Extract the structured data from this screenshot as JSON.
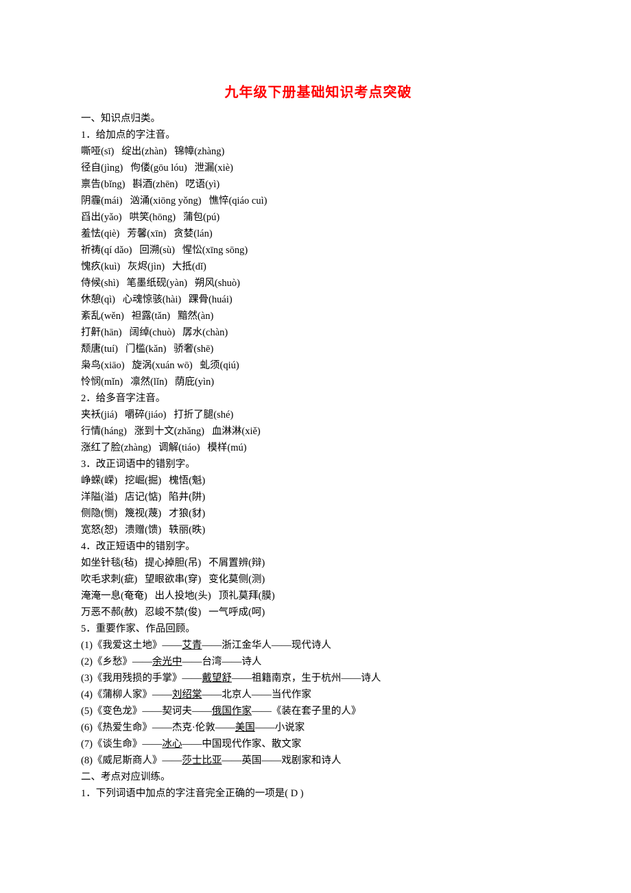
{
  "title": "九年级下册基础知识考点突破",
  "section1": {
    "heading": "一、知识点归类。",
    "sub1": "1．给加点的字注音。",
    "lines1": [
      "嘶哑(sī)   绽出(zhàn)   锦幛(zhàng)",
      "径自(jìng)   佝偻(gōu lóu)   泄漏(xiè)",
      "禀告(bǐng)   斟酒(zhēn)   呓语(yì)",
      "阴霾(mái)   汹涌(xiōng yǒng)   憔悴(qiáo cuì)",
      "舀出(yǎo)   哄笑(hōng)   蒲包(pú)",
      "羞怯(qiè)   芳馨(xīn)   贪婪(lán)",
      "祈祷(qí dǎo)   回溯(sù)   惺忪(xīng sōng)",
      "愧疚(kuì)   灰烬(jìn)   大抵(dǐ)",
      "侍候(shì)   笔墨纸砚(yàn)   朔风(shuò)",
      "休憩(qì)   心魂惊骇(hài)   踝骨(huái)",
      "紊乱(wěn)   袒露(tǎn)   黯然(àn)",
      "打鼾(hān)   阔绰(chuò)   孱水(chàn)",
      "颓唐(tuí)   门槛(kǎn)   骄奢(shē)",
      "枭鸟(xiāo)   旋涡(xuán wō)   虬须(qiú)",
      "怜悯(mǐn)   凛然(lǐn)   荫庇(yìn)"
    ],
    "sub2": "2．给多音字注音。",
    "lines2": [
      "夹袄(jiá)   嚼碎(jiáo)   打折了腿(shé)",
      "行情(háng)   涨到十文(zhǎng)   血淋淋(xiě)",
      "涨红了脸(zhàng)   调解(tiáo)   模样(mú)"
    ],
    "sub3": "3．改正词语中的错别字。",
    "lines3": [
      "峥蝾(嵘)   挖崛(掘)   槐悟(魁)",
      "洋隘(溢)   店记(惦)   陷井(阱)",
      "侧隐(恻)   篾视(蔑)   才狼(豺)",
      "宽怒(恕)   溃赠(馈)   轶丽(昳)"
    ],
    "sub4": "4．改正短语中的错别字。",
    "lines4": [
      "如坐针毯(毡)   提心掉胆(吊)   不屑置辨(辩)",
      "吹毛求刺(疵)   望眼欲串(穿)   变化莫侧(测)",
      "淹淹一息(奄奄)   出人投地(头)   顶礼莫拜(膜)",
      "万恶不郝(赦)   忍峻不禁(俊)   一气呼成(呵)"
    ],
    "sub5": "5．重要作家、作品回顾。",
    "works": [
      {
        "pre": "(1)《我爱这土地》——",
        "u": "艾青",
        "post": "——浙江金华人——现代诗人"
      },
      {
        "pre": "(2)《乡愁》——",
        "u": "余光中",
        "post": "——台湾——诗人"
      },
      {
        "pre": "(3)《我用残损的手掌》——",
        "u": "戴望舒",
        "post": "——祖籍南京，生于杭州——诗人"
      },
      {
        "pre": "(4)《蒲柳人家》——",
        "u": "刘绍棠",
        "post": "——北京人——当代作家"
      },
      {
        "pre": "(5)《变色龙》——契诃夫——",
        "u": "俄国作家",
        "post": "——《装在套子里的人》"
      },
      {
        "pre": "(6)《热爱生命》——杰克·伦敦——",
        "u": "美国",
        "post": "——小说家"
      },
      {
        "pre": "(7)《谈生命》——",
        "u": "冰心",
        "post": "——中国现代作家、散文家"
      },
      {
        "pre": "(8)《威尼斯商人》——",
        "u": "莎士比亚",
        "post": "——英国——戏剧家和诗人"
      }
    ]
  },
  "section2": {
    "heading": "二、考点对应训练。",
    "q1": "1．下列词语中加点的字注音完全正确的一项是( D )"
  }
}
